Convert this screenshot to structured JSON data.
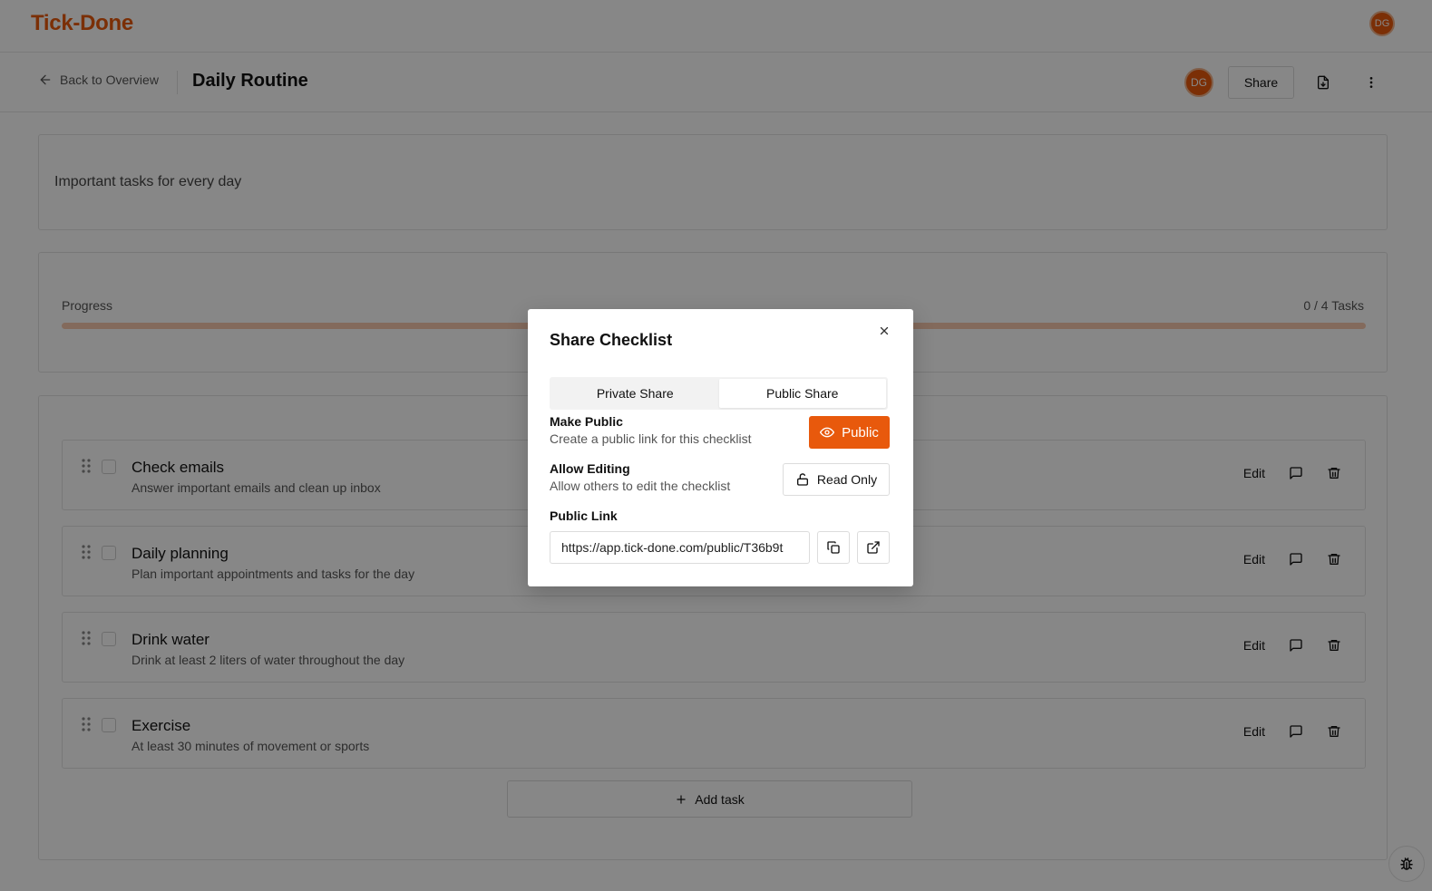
{
  "app": {
    "brand": "Tick-Done",
    "user_initials": "DG"
  },
  "header": {
    "back_label": "Back to Overview",
    "title": "Daily Routine",
    "share_label": "Share"
  },
  "description": "Important tasks for every day",
  "progress": {
    "label": "Progress",
    "count": "0 / 4 Tasks",
    "fraction": 0
  },
  "tasks": [
    {
      "title": "Check emails",
      "subtitle": "Answer important emails and clean up inbox",
      "edit": "Edit"
    },
    {
      "title": "Daily planning",
      "subtitle": "Plan important appointments and tasks for the day",
      "edit": "Edit"
    },
    {
      "title": "Drink water",
      "subtitle": "Drink at least 2 liters of water throughout the day",
      "edit": "Edit"
    },
    {
      "title": "Exercise",
      "subtitle": "At least 30 minutes of movement or sports",
      "edit": "Edit"
    }
  ],
  "add_task_label": "Add task",
  "modal": {
    "title": "Share Checklist",
    "tabs": [
      {
        "label": "Private Share",
        "active": false
      },
      {
        "label": "Public Share",
        "active": true
      }
    ],
    "make_public": {
      "label": "Make Public",
      "help": "Create a public link for this checklist",
      "button": "Public"
    },
    "allow_editing": {
      "label": "Allow Editing",
      "help": "Allow others to edit the checklist",
      "button": "Read Only"
    },
    "public_link": {
      "label": "Public Link",
      "value": "https://app.tick-done.com/public/T36b9t"
    }
  },
  "colors": {
    "accent": "#e8590c",
    "accent_light": "#f7c9ae",
    "overlay": "rgba(0,0,0,0.47)"
  }
}
